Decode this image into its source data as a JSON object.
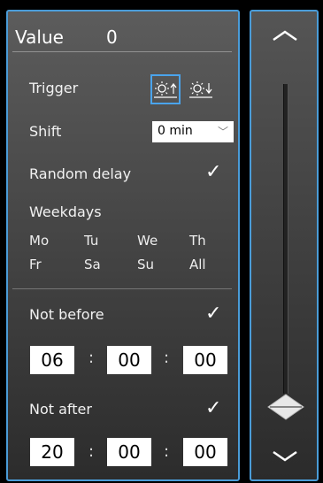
{
  "header": {
    "label": "Value",
    "value": "0"
  },
  "trigger": {
    "label": "Trigger",
    "up_icon": "sunrise-icon",
    "down_icon": "sunset-icon"
  },
  "shift": {
    "label": "Shift",
    "value": "0 min"
  },
  "random_delay": {
    "label": "Random delay",
    "checked": true
  },
  "weekdays": {
    "label": "Weekdays",
    "row1": [
      "Mo",
      "Tu",
      "We",
      "Th"
    ],
    "row2": [
      "Fr",
      "Sa",
      "Su",
      "All"
    ]
  },
  "not_before": {
    "label": "Not before",
    "checked": true,
    "hh": "06",
    "mm": "00",
    "ss": "00"
  },
  "not_after": {
    "label": "Not after",
    "checked": true,
    "hh": "20",
    "mm": "00",
    "ss": "00"
  },
  "colon": ":",
  "check_glyph": "✓",
  "slider": {
    "level": 0.02,
    "up_icon": "chevron-up-icon",
    "down_icon": "chevron-down-icon"
  },
  "colors": {
    "accent": "#4a9cd8",
    "panel_top": "#5c5c5c",
    "panel_bottom": "#2c2c2c"
  }
}
